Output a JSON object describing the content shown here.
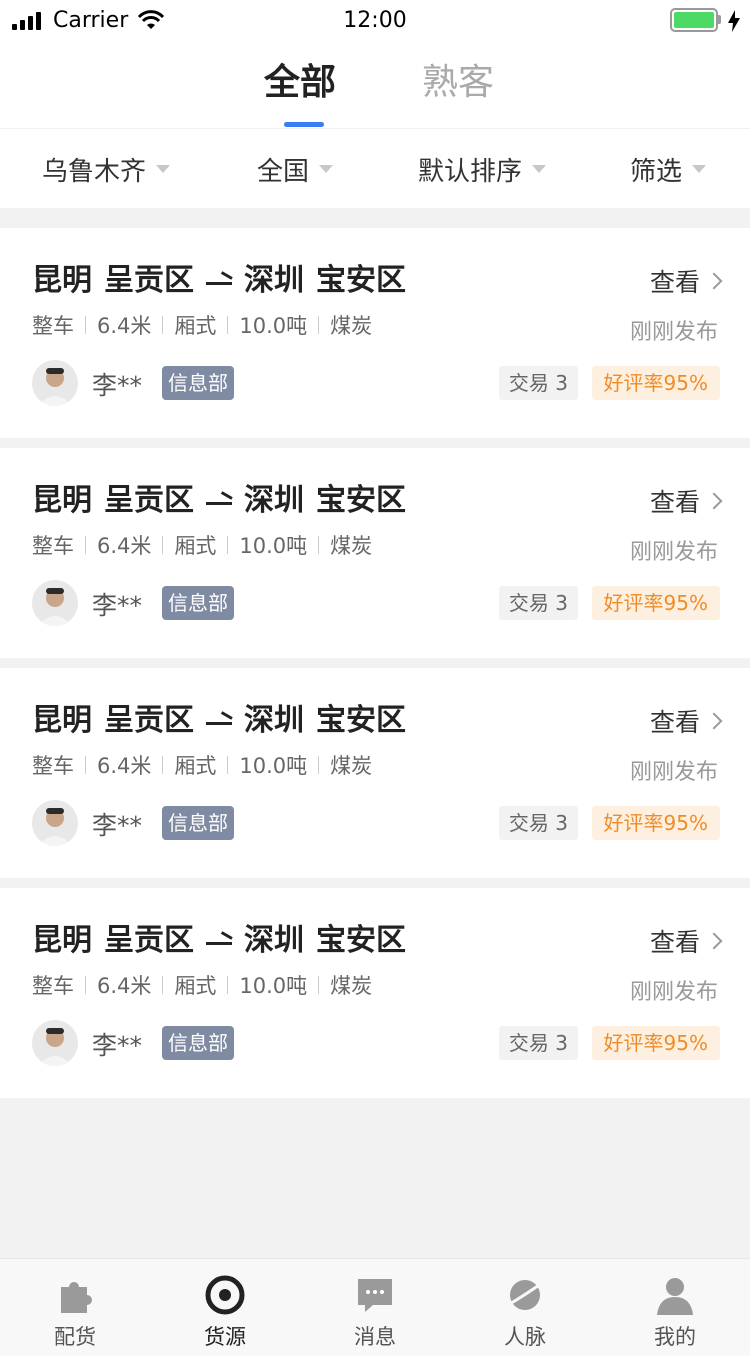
{
  "status_bar": {
    "carrier": "Carrier",
    "time": "12:00"
  },
  "top_tabs": [
    {
      "label": "全部",
      "active": true
    },
    {
      "label": "熟客",
      "active": false
    }
  ],
  "filters": [
    {
      "label": "乌鲁木齐"
    },
    {
      "label": "全国"
    },
    {
      "label": "默认排序"
    },
    {
      "label": "筛选"
    }
  ],
  "listings": [
    {
      "origin_city": "昆明",
      "origin_district": "呈贡区",
      "dest_city": "深圳",
      "dest_district": "宝安区",
      "specs": [
        "整车",
        "6.4米",
        "厢式",
        "10.0吨",
        "煤炭"
      ],
      "view_label": "查看",
      "posted": "刚刚发布",
      "poster_name": "李**",
      "poster_tag": "信息部",
      "trade": "交易 3",
      "rating": "好评率95%"
    },
    {
      "origin_city": "昆明",
      "origin_district": "呈贡区",
      "dest_city": "深圳",
      "dest_district": "宝安区",
      "specs": [
        "整车",
        "6.4米",
        "厢式",
        "10.0吨",
        "煤炭"
      ],
      "view_label": "查看",
      "posted": "刚刚发布",
      "poster_name": "李**",
      "poster_tag": "信息部",
      "trade": "交易 3",
      "rating": "好评率95%"
    },
    {
      "origin_city": "昆明",
      "origin_district": "呈贡区",
      "dest_city": "深圳",
      "dest_district": "宝安区",
      "specs": [
        "整车",
        "6.4米",
        "厢式",
        "10.0吨",
        "煤炭"
      ],
      "view_label": "查看",
      "posted": "刚刚发布",
      "poster_name": "李**",
      "poster_tag": "信息部",
      "trade": "交易 3",
      "rating": "好评率95%"
    },
    {
      "origin_city": "昆明",
      "origin_district": "呈贡区",
      "dest_city": "深圳",
      "dest_district": "宝安区",
      "specs": [
        "整车",
        "6.4米",
        "厢式",
        "10.0吨",
        "煤炭"
      ],
      "view_label": "查看",
      "posted": "刚刚发布",
      "poster_name": "李**",
      "poster_tag": "信息部",
      "trade": "交易 3",
      "rating": "好评率95%"
    }
  ],
  "tabbar": [
    {
      "label": "配货",
      "icon": "puzzle-icon",
      "active": false
    },
    {
      "label": "货源",
      "icon": "target-icon",
      "active": true
    },
    {
      "label": "消息",
      "icon": "chat-icon",
      "active": false
    },
    {
      "label": "人脉",
      "icon": "planet-icon",
      "active": false
    },
    {
      "label": "我的",
      "icon": "person-icon",
      "active": false
    }
  ],
  "colors": {
    "accent": "#3a7af5",
    "tag_bg": "#7f8aa3",
    "rating_text": "#f08c28",
    "rating_bg": "#fdf0e0",
    "battery": "#4cd964"
  }
}
